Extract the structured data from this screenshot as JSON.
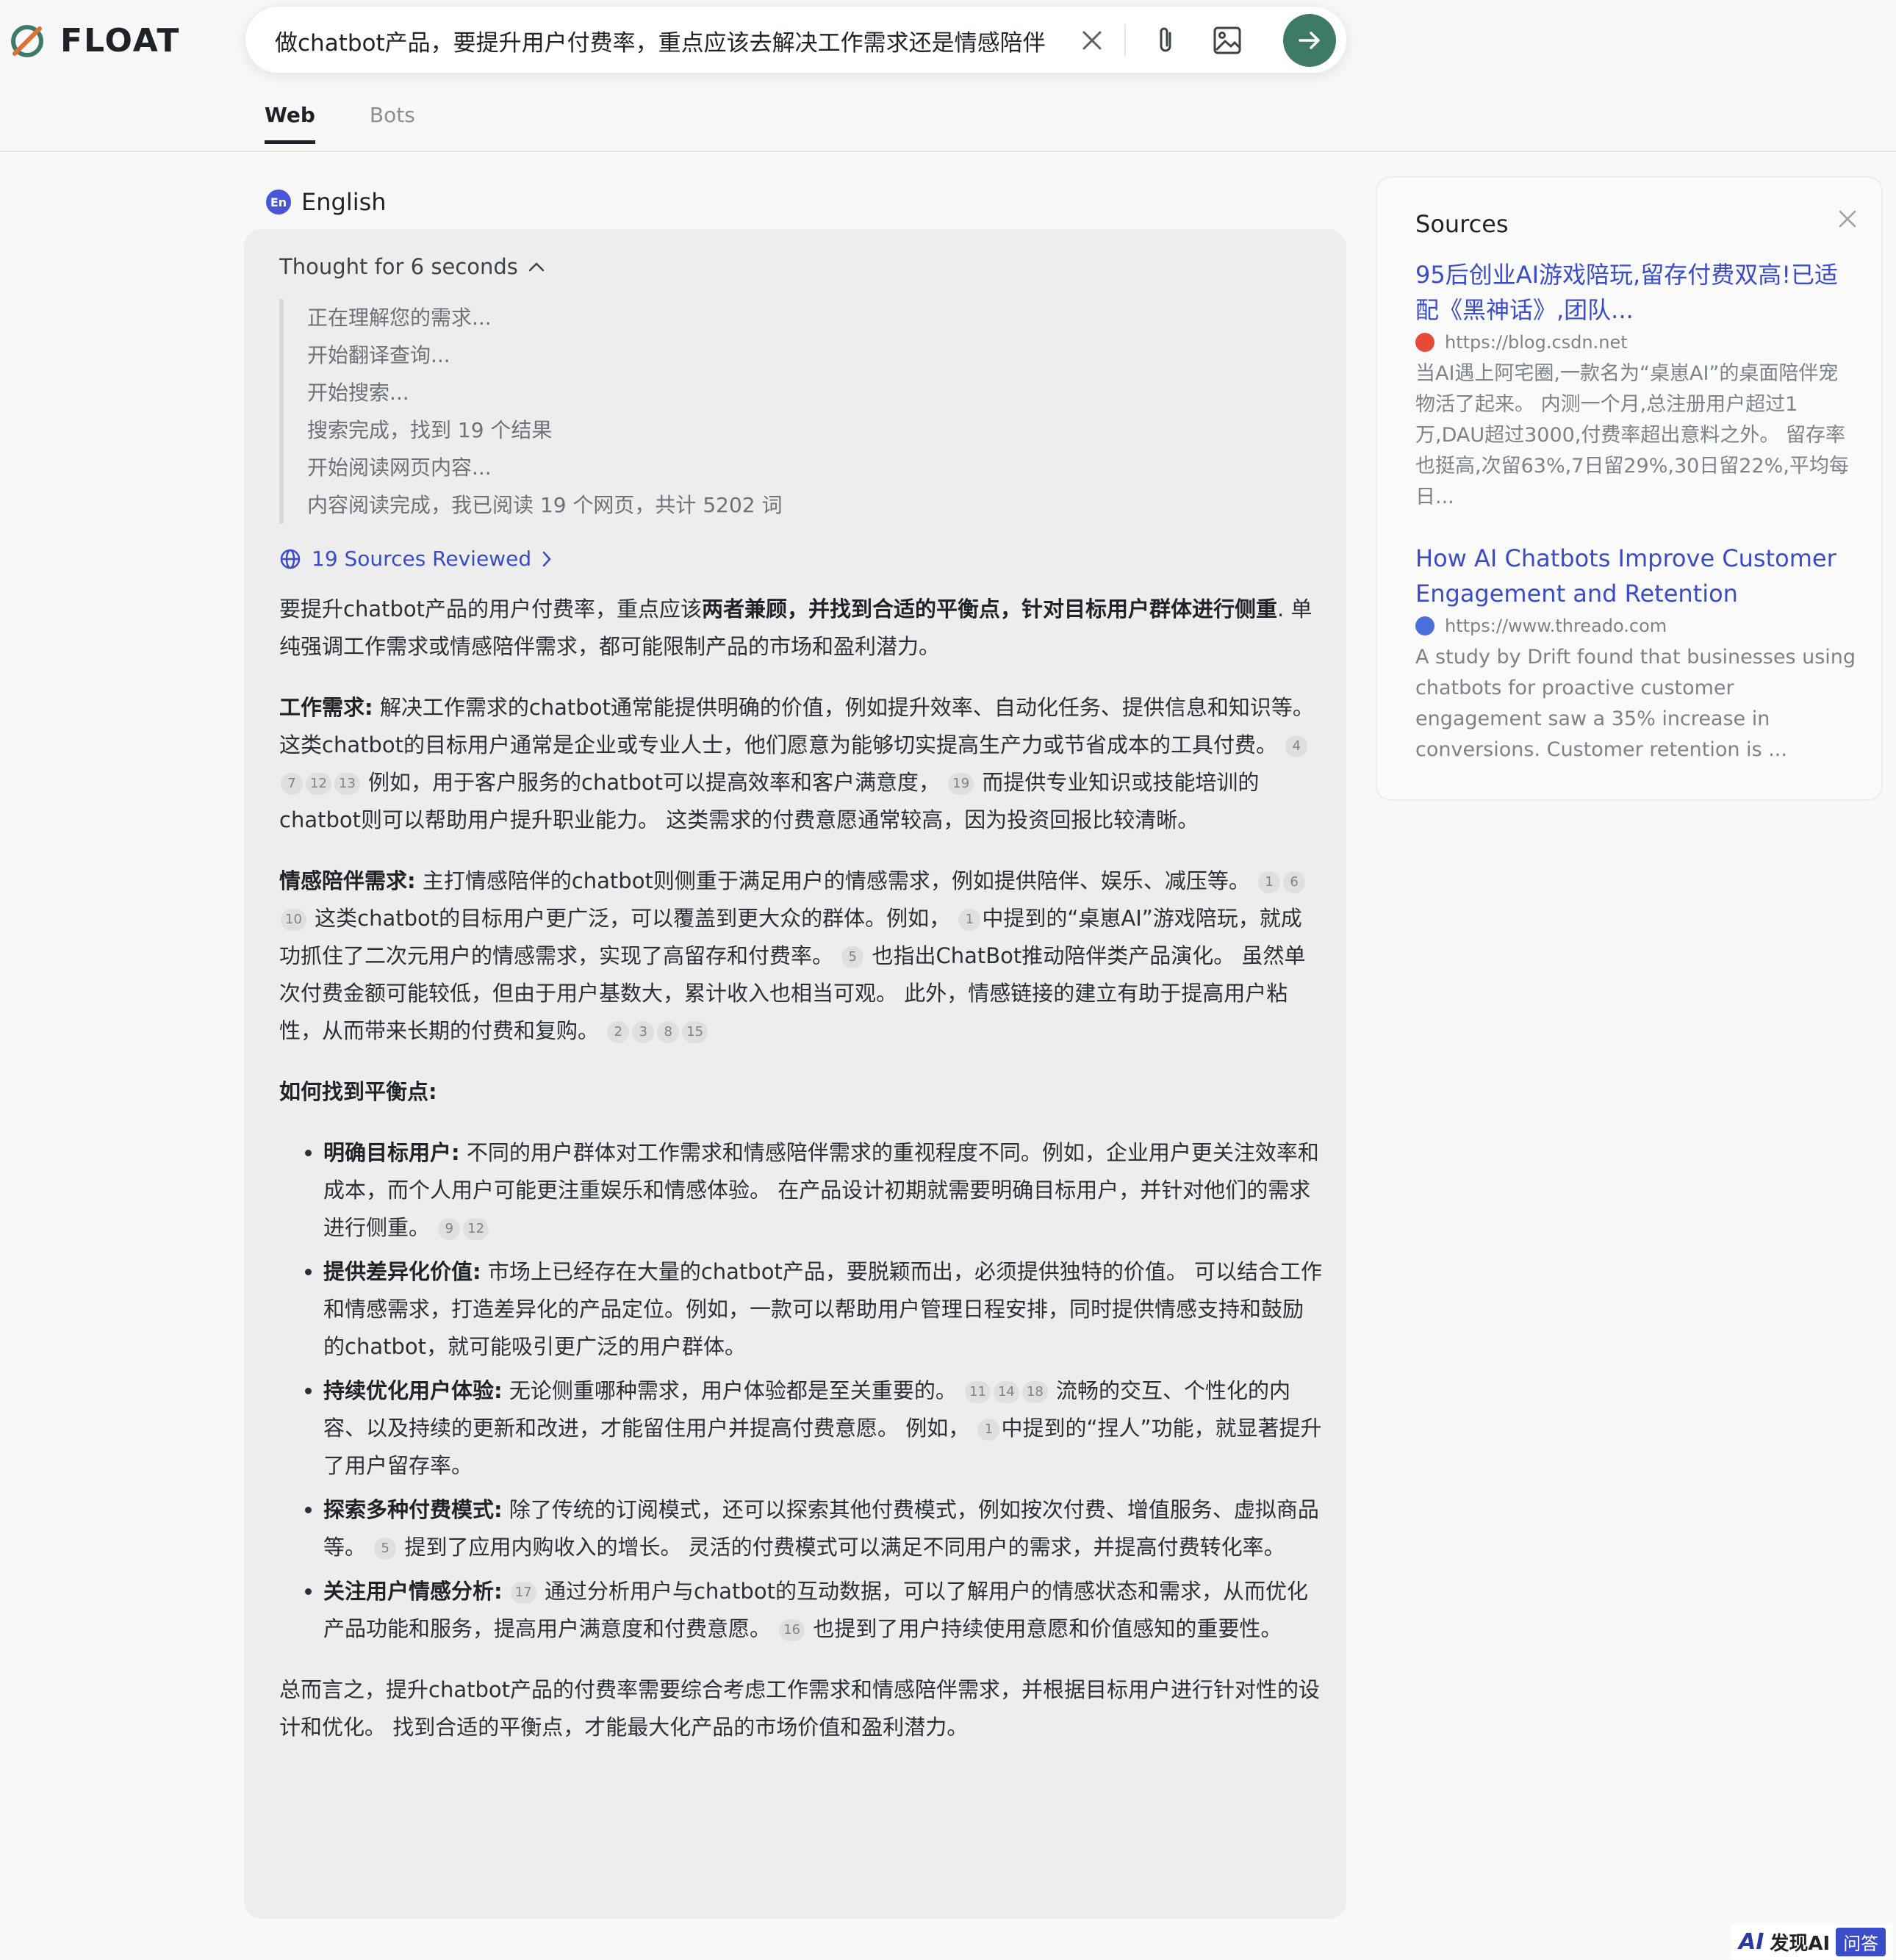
{
  "app": {
    "brand": "FLOAT"
  },
  "search": {
    "query": "做chatbot产品，要提升用户付费率，重点应该去解决工作需求还是情感陪伴"
  },
  "tabs": [
    {
      "label": "Web",
      "active": true
    },
    {
      "label": "Bots",
      "active": false
    }
  ],
  "language": {
    "badge": "En",
    "label": "English"
  },
  "thought": {
    "label": "Thought for 6 seconds",
    "steps": [
      "正在理解您的需求...",
      "开始翻译查询...",
      "开始搜索...",
      "搜索完成，找到 19 个结果",
      "开始阅读网页内容...",
      "内容阅读完成，我已阅读 19 个网页，共计 5202 词"
    ]
  },
  "sources_reviewed": "19 Sources Reviewed",
  "answer": {
    "intro_pre": "要提升chatbot产品的用户付费率，重点应该",
    "intro_bold": "两者兼顾，并找到合适的平衡点，针对目标用户群体进行侧重",
    "intro_post": ". 单纯强调工作需求或情感陪伴需求，都可能限制产品的市场和盈利潜力。",
    "work": {
      "label": "工作需求:",
      "text1": " 解决工作需求的chatbot通常能提供明确的价值，例如提升效率、自动化任务、提供信息和知识等。这类chatbot的目标用户通常是企业或专业人士，他们愿意为能够切实提高生产力或节省成本的工具付费。",
      "cites1": [
        "4",
        "7",
        "12",
        "13"
      ],
      "text2": " 例如，用于客户服务的chatbot可以提高效率和客户满意度，",
      "cites2": [
        "19"
      ],
      "text3": " 而提供专业知识或技能培训的chatbot则可以帮助用户提升职业能力。 这类需求的付费意愿通常较高，因为投资回报比较清晰。"
    },
    "emotion": {
      "label": "情感陪伴需求:",
      "text1": " 主打情感陪伴的chatbot则侧重于满足用户的情感需求，例如提供陪伴、娱乐、减压等。",
      "cites1": [
        "1",
        "6",
        "10"
      ],
      "text2": " 这类chatbot的目标用户更广泛，可以覆盖到更大众的群体。例如，",
      "cites2": [
        "1"
      ],
      "text3": "中提到的“桌崽AI”游戏陪玩，就成功抓住了二次元用户的情感需求，实现了高留存和付费率。",
      "cites3": [
        "5"
      ],
      "text4": " 也指出ChatBot推动陪伴类产品演化。 虽然单次付费金额可能较低，但由于用户基数大，累计收入也相当可观。 此外，情感链接的建立有助于提高用户粘性，从而带来长期的付费和复购。",
      "cites4": [
        "2",
        "3",
        "8",
        "15"
      ]
    },
    "balance_heading": "如何找到平衡点:",
    "bullets": [
      {
        "label": "明确目标用户:",
        "text1": " 不同的用户群体对工作需求和情感陪伴需求的重视程度不同。例如，企业用户更关注效率和成本，而个人用户可能更注重娱乐和情感体验。 在产品设计初期就需要明确目标用户，并针对他们的需求进行侧重。",
        "cites1": [
          "9",
          "12"
        ]
      },
      {
        "label": "提供差异化价值:",
        "text1": " 市场上已经存在大量的chatbot产品，要脱颖而出，必须提供独特的价值。 可以结合工作和情感需求，打造差异化的产品定位。例如，一款可以帮助用户管理日程安排，同时提供情感支持和鼓励的chatbot，就可能吸引更广泛的用户群体。"
      },
      {
        "label": "持续优化用户体验:",
        "text1": " 无论侧重哪种需求，用户体验都是至关重要的。",
        "cites1": [
          "11",
          "14",
          "18"
        ],
        "text2": " 流畅的交互、个性化的内容、以及持续的更新和改进，才能留住用户并提高付费意愿。 例如，",
        "cites2": [
          "1"
        ],
        "text3": "中提到的“捏人”功能，就显著提升了用户留存率。"
      },
      {
        "label": "探索多种付费模式:",
        "text1": " 除了传统的订阅模式，还可以探索其他付费模式，例如按次付费、增值服务、虚拟商品等。",
        "cites1": [
          "5"
        ],
        "text2": " 提到了应用内购收入的增长。 灵活的付费模式可以满足不同用户的需求，并提高付费转化率。"
      },
      {
        "label": "关注用户情感分析:",
        "text1": " ",
        "cites1": [
          "17"
        ],
        "text2": " 通过分析用户与chatbot的互动数据，可以了解用户的情感状态和需求，从而优化产品功能和服务，提高用户满意度和付费意愿。",
        "cites2": [
          "16"
        ],
        "text3": " 也提到了用户持续使用意愿和价值感知的重要性。"
      }
    ],
    "conclusion": "总而言之，提升chatbot产品的付费率需要综合考虑工作需求和情感陪伴需求，并根据目标用户进行针对性的设计和优化。 找到合适的平衡点，才能最大化产品的市场价值和盈利潜力。"
  },
  "sources_panel": {
    "title": "Sources",
    "items": [
      {
        "title": "95后创业AI游戏陪玩,留存付费双高!已适配《黑神话》,团队...",
        "url": "https://blog.csdn.net",
        "favicon_color": "#e84a3a",
        "snippet": "当AI遇上阿宅圈,一款名为“桌崽AI”的桌面陪伴宠物活了起来。 内测一个月,总注册用户超过1万,DAU超过3000,付费率超出意料之外。 留存率也挺高,次留63%,7日留29%,30日留22%,平均每日..."
      },
      {
        "title": "How AI Chatbots Improve Customer Engagement and Retention",
        "url": "https://www.threado.com",
        "favicon_color": "#4a6fd8",
        "snippet": "A study by Drift found that businesses using chatbots for proactive customer engagement saw a 35% increase in conversions. Customer retention is ..."
      }
    ]
  },
  "watermark": {
    "ai": "AI",
    "text": "发现AI",
    "tag": "问答"
  },
  "colors": {
    "accent": "#3f7a66",
    "link": "#3b4cc9",
    "lang_badge": "#4a56d8"
  }
}
